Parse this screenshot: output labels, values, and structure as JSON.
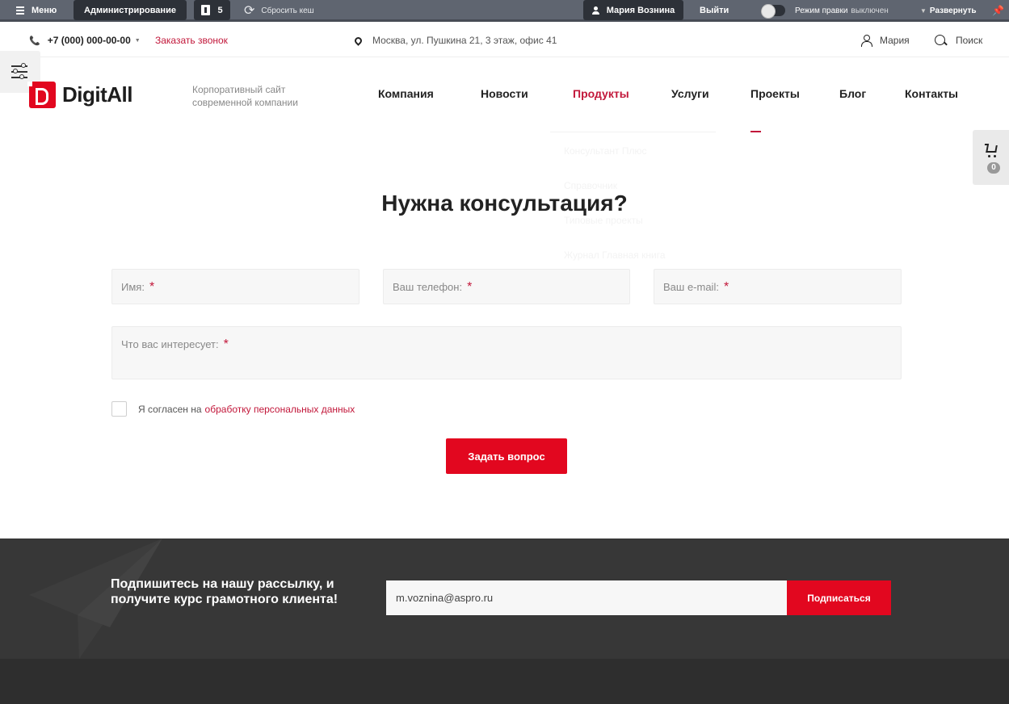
{
  "admin_bar": {
    "menu_label": "Меню",
    "admin_label": "Администрирование",
    "notifications_count": "5",
    "clear_cache_label": "Сбросить кеш",
    "user_name": "Мария Вознина",
    "logout_label": "Выйти",
    "edit_mode_label": "Режим правки",
    "edit_mode_state": "выключен",
    "expand_label": "Развернуть"
  },
  "topline": {
    "phone": "+7 (000) 000-00-00",
    "callback_label": "Заказать звонок",
    "address": "Москва, ул. Пушкина 21, 3 этаж, офис 41",
    "account_name": "Мария",
    "search_label": "Поиск"
  },
  "header": {
    "logo_text": "DigitAll",
    "slogan": "Корпоративный сайт современной компании",
    "nav": [
      "Компания",
      "Новости",
      "Продукты",
      "Услуги",
      "Проекты",
      "Блог",
      "Контакты"
    ],
    "active_nav": "Продукты",
    "dropdown_items": [
      "Консультант Плюс",
      "Справочник",
      "Типовые проекты",
      "Журнал Главная книга"
    ]
  },
  "cart": {
    "count": "0"
  },
  "form": {
    "title": "Нужна консультация?",
    "name_placeholder": "Имя:",
    "phone_placeholder": "Ваш телефон:",
    "email_placeholder": "Ваш e-mail:",
    "interest_placeholder": "Что вас интересует:",
    "required_mark": "*",
    "consent_text": "Я согласен на",
    "consent_link": "обработку персональных данных",
    "submit_label": "Задать вопрос"
  },
  "subscribe": {
    "text": "Подпишитесь на нашу рассылку, и получите курс грамотного клиента!",
    "email_value": "m.voznina@aspro.ru",
    "button_label": "Подписаться"
  },
  "colors": {
    "accent": "#e2071f",
    "link": "#c2173a",
    "admin_bar": "#5f6570",
    "subscribe_bg": "#373737"
  }
}
